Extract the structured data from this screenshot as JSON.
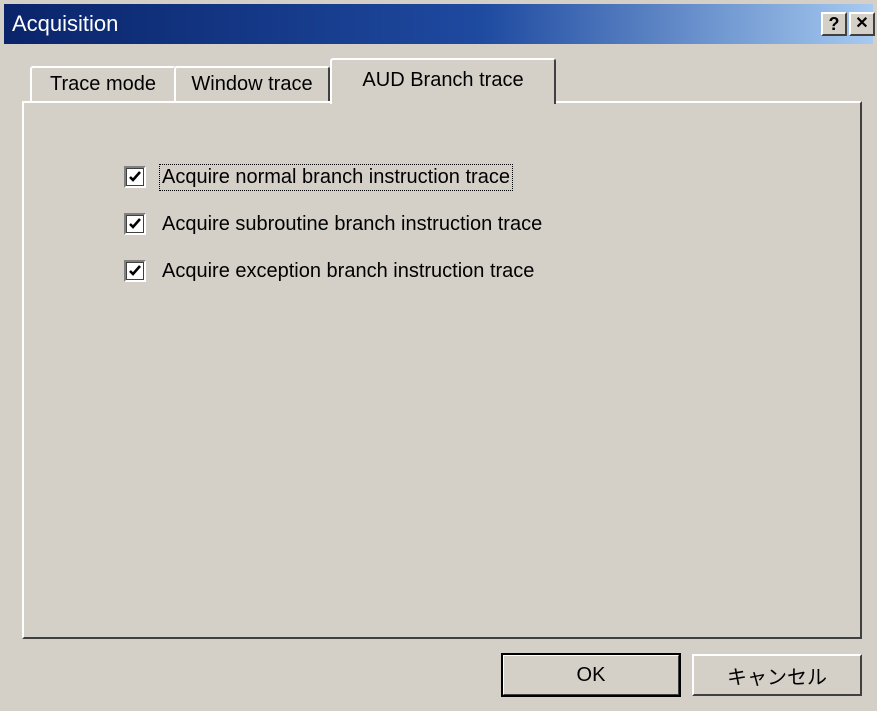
{
  "window": {
    "title": "Acquisition",
    "help_button": "?",
    "close_button": "✕"
  },
  "tabs": [
    {
      "label": "Trace mode",
      "active": false
    },
    {
      "label": "Window trace",
      "active": false
    },
    {
      "label": "AUD Branch trace",
      "active": true
    }
  ],
  "options": [
    {
      "label": "Acquire normal branch instruction trace",
      "checked": true,
      "focused": true
    },
    {
      "label": "Acquire subroutine branch instruction trace",
      "checked": true,
      "focused": false
    },
    {
      "label": "Acquire exception branch instruction trace",
      "checked": true,
      "focused": false
    }
  ],
  "buttons": {
    "ok": "OK",
    "cancel": "キャンセル"
  },
  "colors": {
    "face": "#d4d0c8",
    "title_start": "#0a246a",
    "title_end": "#a6caf0"
  }
}
